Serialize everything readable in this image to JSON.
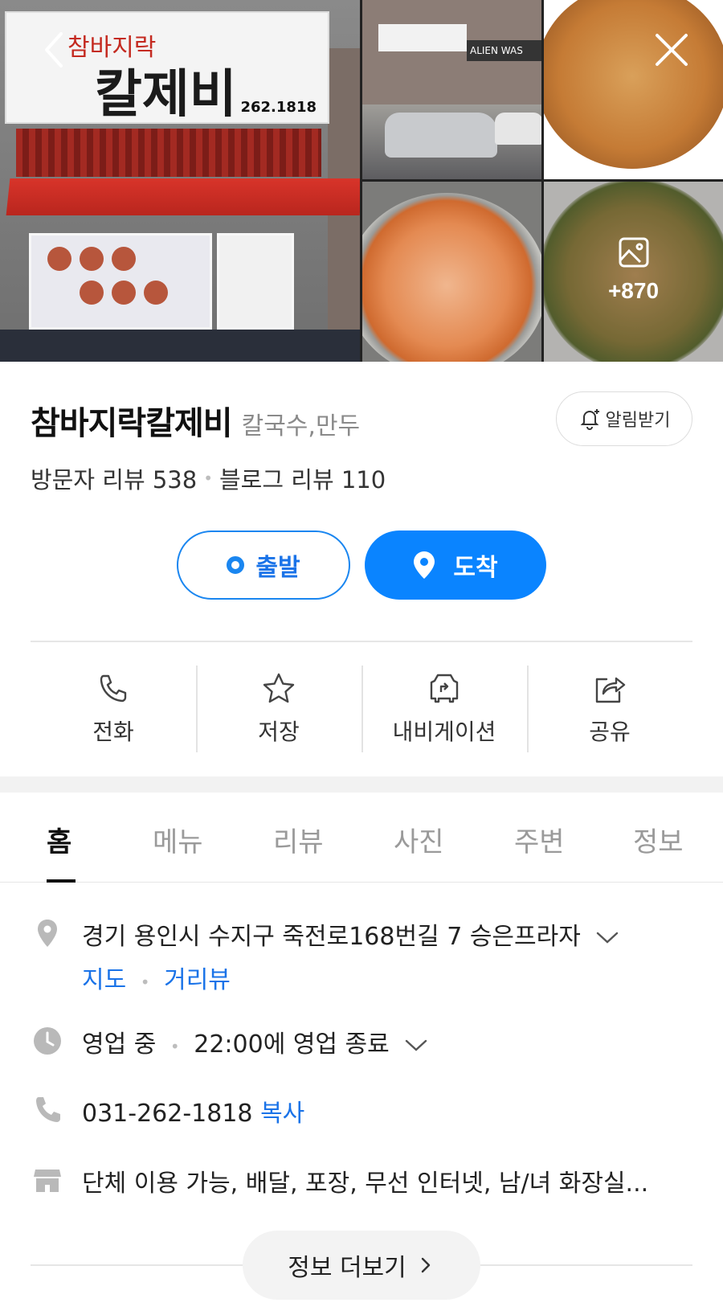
{
  "photos": {
    "main_sign_top": "참바지락",
    "main_sign_big": "칼제비",
    "main_sign_phone": "262.1818",
    "street_sign": "ALIEN WAS",
    "more_count": "+870"
  },
  "header": {
    "back_icon": "chevron-left-icon",
    "close_icon": "close-icon"
  },
  "place": {
    "name": "참바지락칼제비",
    "category": "칼국수,만두",
    "alarm_label": "알림받기",
    "visitor_reviews": "방문자 리뷰 538",
    "blog_reviews": "블로그 리뷰 110"
  },
  "route": {
    "depart_label": "출발",
    "arrive_label": "도착"
  },
  "actions": [
    {
      "label": "전화",
      "icon": "phone-icon"
    },
    {
      "label": "저장",
      "icon": "star-icon"
    },
    {
      "label": "내비게이션",
      "icon": "navigation-car-icon"
    },
    {
      "label": "공유",
      "icon": "share-icon"
    }
  ],
  "tabs": [
    {
      "label": "홈",
      "active": true
    },
    {
      "label": "메뉴",
      "active": false
    },
    {
      "label": "리뷰",
      "active": false
    },
    {
      "label": "사진",
      "active": false
    },
    {
      "label": "주변",
      "active": false
    },
    {
      "label": "정보",
      "active": false
    }
  ],
  "info": {
    "address": "경기 용인시 수지구 죽전로168번길 7 승은프라자",
    "map_link": "지도",
    "roadview_link": "거리뷰",
    "status": "영업 중",
    "hours": "22:00에 영업 종료",
    "phone": "031-262-1818",
    "copy_label": "복사",
    "facilities": "단체 이용 가능, 배달, 포장, 무선 인터넷, 남/녀 화장실..."
  },
  "more_info_label": "정보 더보기",
  "colors": {
    "accent": "#0a84ff",
    "link": "#1a73e8"
  }
}
